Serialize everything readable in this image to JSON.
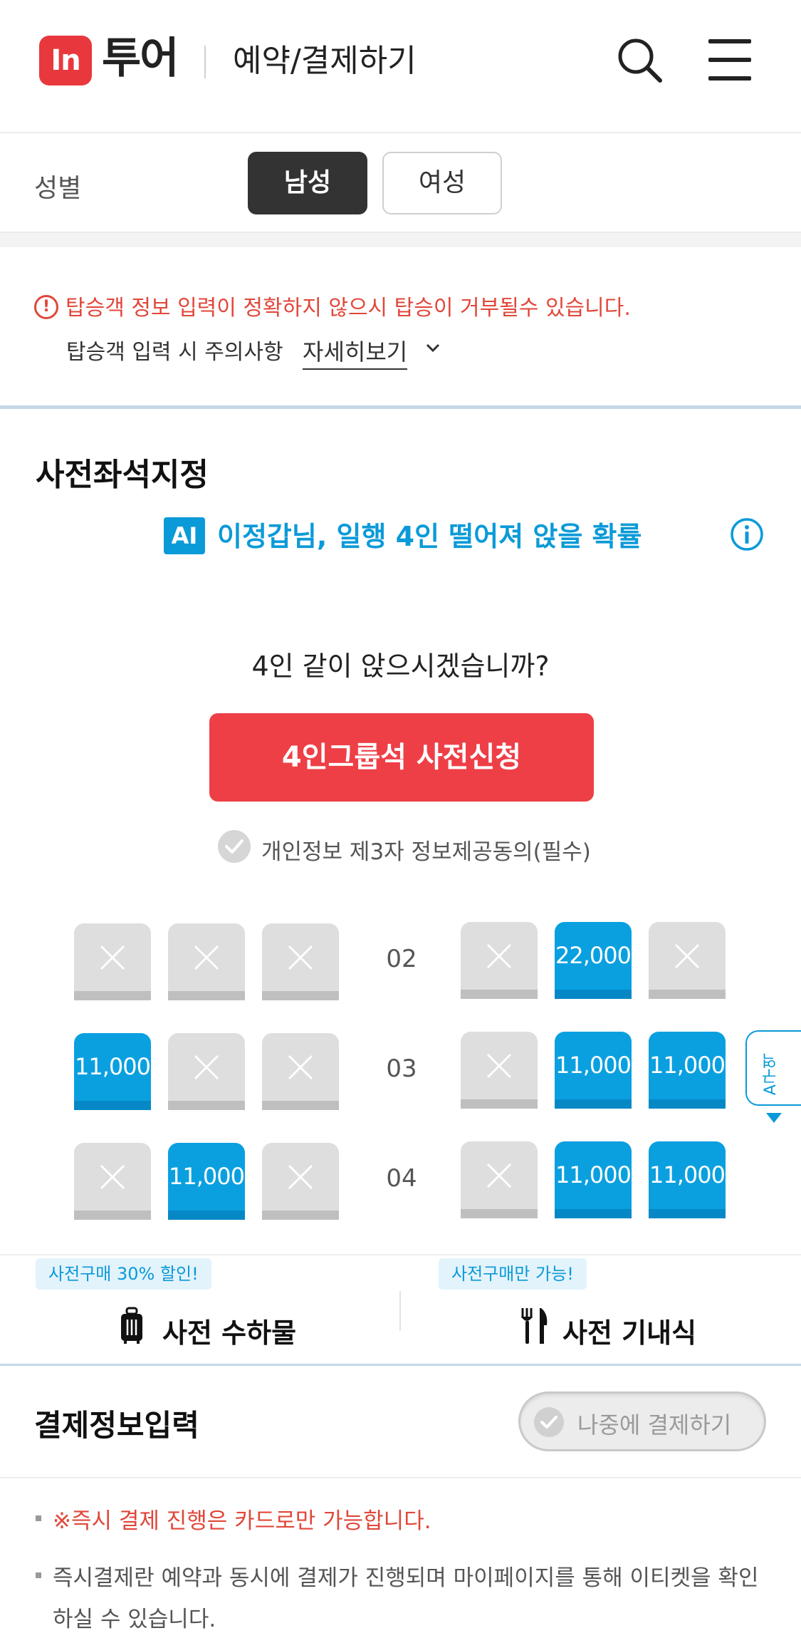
{
  "header": {
    "logo_badge": "In",
    "logo_text": "투어",
    "title": "예약/결제하기",
    "search_icon": "search-icon",
    "menu_icon": "hamburger-menu-icon"
  },
  "gender": {
    "label": "성별",
    "options": [
      "남성",
      "여성"
    ],
    "selected": "남성"
  },
  "warning": {
    "message": "탑승객 정보 입력이 정확하지 않으시 탑승이 거부될수 있습니다.",
    "note_label": "탑승객 입력 시 주의사항",
    "detail_link": "자세히보기"
  },
  "seat_preassign": {
    "title": "사전좌석지정",
    "ai_badge": "AI",
    "ai_message": "이정갑님, 일행 4인 떨어져 앉을 확률",
    "question": "4인 같이 앉으시겠습니까?",
    "group_button": "4인그룹석 사전신청",
    "consent_text": "개인정보 제3자 정보제공동의(필수)"
  },
  "seat_map": {
    "rows": [
      {
        "row": "02",
        "left": [
          null,
          null,
          null
        ],
        "right": [
          null,
          "22,000",
          null
        ]
      },
      {
        "row": "03",
        "left": [
          "11,000",
          null,
          null
        ],
        "right": [
          null,
          "11,000",
          "11,000"
        ]
      },
      {
        "row": "04",
        "left": [
          null,
          "11,000",
          null
        ],
        "right": [
          null,
          "11,000",
          "11,000"
        ]
      }
    ],
    "zone_tab": "A구역",
    "colors": {
      "available": "#0aa0e0",
      "unavailable": "#dedede"
    }
  },
  "services": {
    "baggage_badge": "사전구매 30% 할인!",
    "baggage_label": "사전 수하물",
    "meal_badge": "사전구매만 가능!",
    "meal_label": "사전 기내식"
  },
  "payment": {
    "title": "결제정보입력",
    "later_button": "나중에 결제하기",
    "note_card_only": "※즉시 결제 진행은 카드로만 가능합니다.",
    "note_instant_line1": "즉시결제란 예약과 동시에 결제가 진행되며 마이페이지를 통해 이티켓을 확인",
    "note_instant_line2": "하실 수 있습니다."
  },
  "colors": {
    "brand_red": "#e8383d",
    "accent_blue": "#0b9ad8",
    "button_red": "#ee3f47"
  }
}
